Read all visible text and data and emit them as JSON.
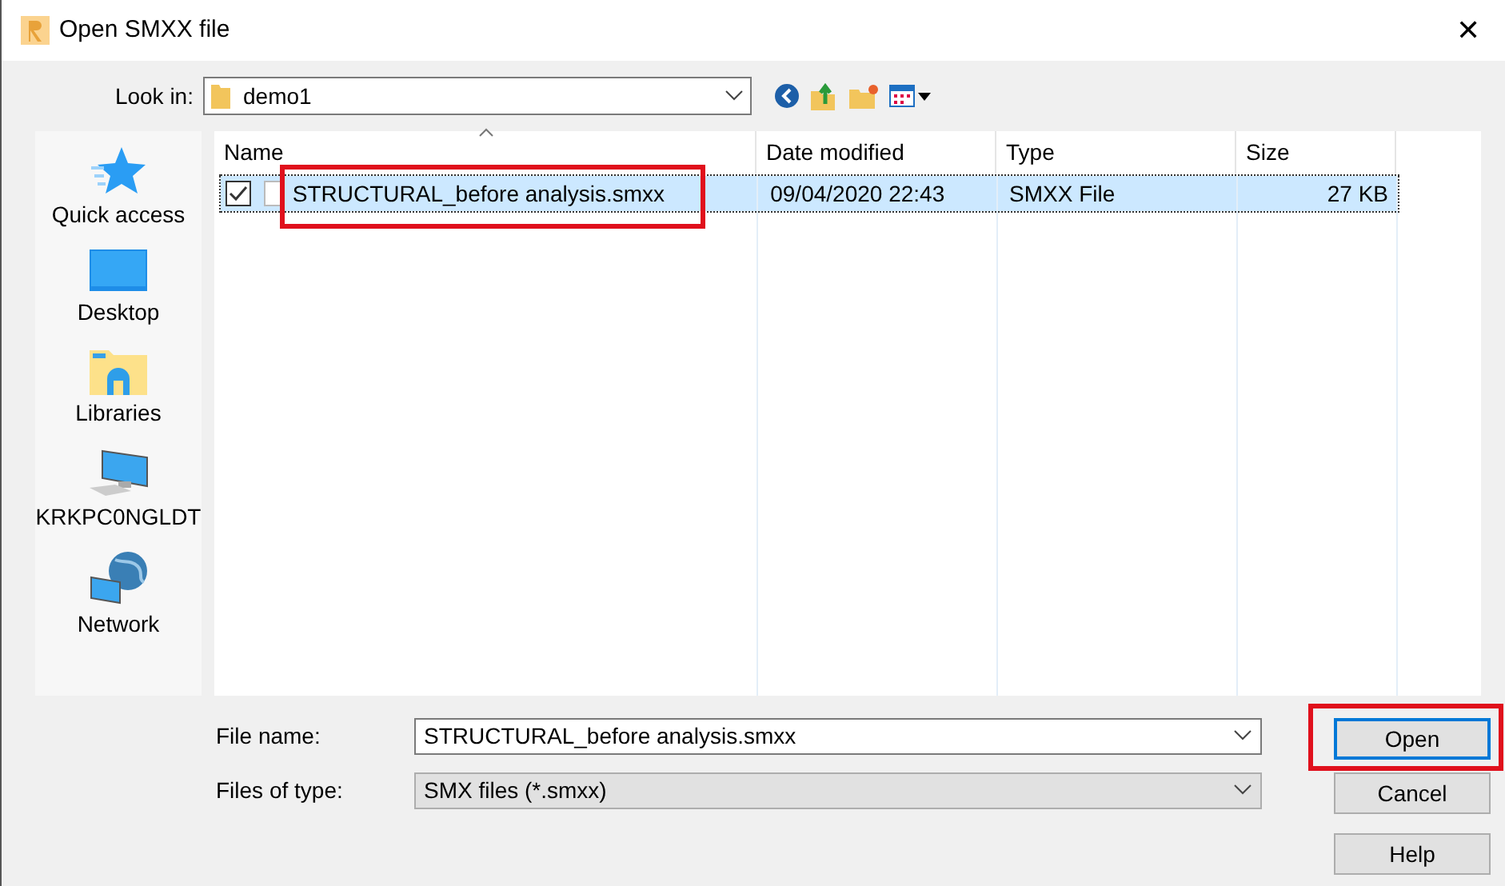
{
  "window": {
    "title": "Open SMXX file",
    "close": "✕"
  },
  "look_in": {
    "label": "Look in:",
    "value": "demo1"
  },
  "places": [
    {
      "label": "Quick access",
      "kind": "star"
    },
    {
      "label": "Desktop",
      "kind": "desktop"
    },
    {
      "label": "Libraries",
      "kind": "libraries"
    },
    {
      "label": "KRKPC0NGLDT",
      "kind": "computer"
    },
    {
      "label": "Network",
      "kind": "network"
    }
  ],
  "table": {
    "columns": [
      "Name",
      "Date modified",
      "Type",
      "Size"
    ],
    "rows": [
      {
        "name": "STRUCTURAL_before analysis.smxx",
        "date": "09/04/2020 22:43",
        "type": "SMXX File",
        "size": "27 KB",
        "checked": true,
        "selected": true,
        "highlighted": true
      }
    ]
  },
  "file_name": {
    "label": "File name:",
    "value": "STRUCTURAL_before analysis.smxx"
  },
  "file_type": {
    "label": "Files of type:",
    "value": "SMX files (*.smxx)"
  },
  "buttons": [
    {
      "label": "Open",
      "default": true,
      "highlighted": true
    },
    {
      "label": "Cancel",
      "default": false,
      "highlighted": false
    },
    {
      "label": "Help",
      "default": false,
      "highlighted": false
    }
  ]
}
